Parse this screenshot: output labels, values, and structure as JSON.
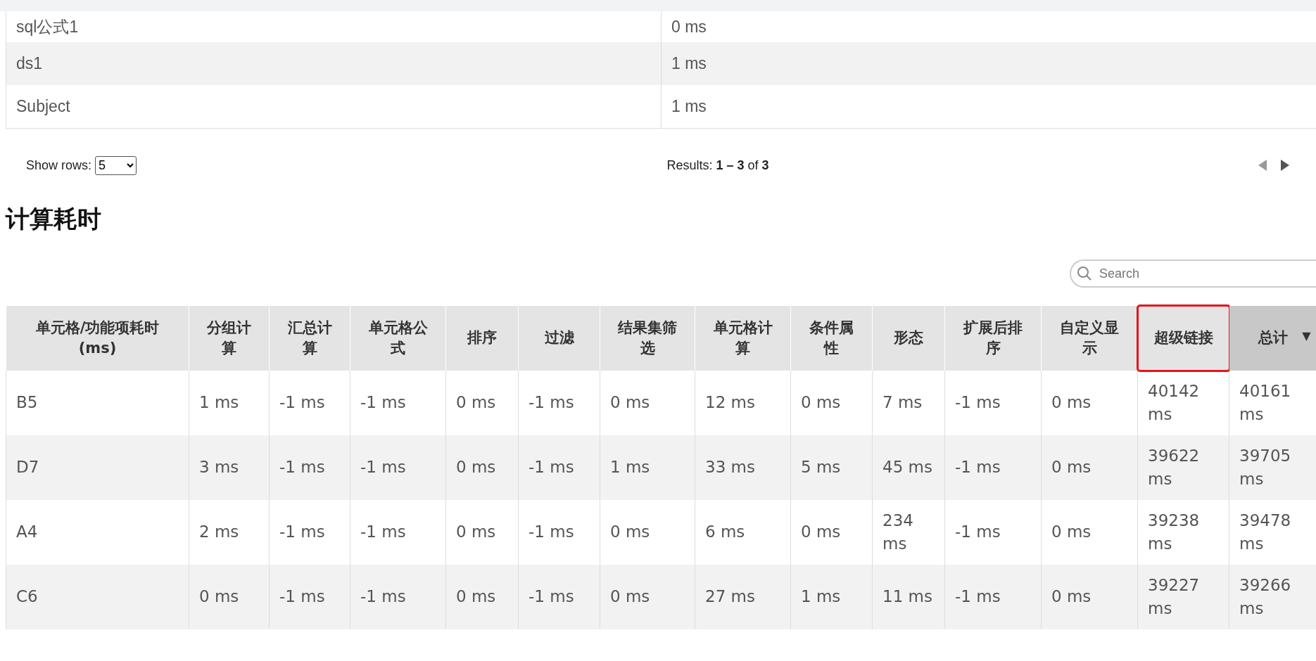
{
  "top_table": {
    "rows": [
      {
        "name": "sql公式1",
        "time": "0 ms"
      },
      {
        "name": "ds1",
        "time": "1 ms"
      },
      {
        "name": "Subject",
        "time": "1 ms"
      }
    ]
  },
  "pagination": {
    "show_rows_label": "Show rows:",
    "rows_value": "5",
    "results_prefix": "Results: ",
    "results_range": "1 – 3",
    "results_of": " of ",
    "results_total": "3",
    "prev_disabled": true,
    "next_disabled": false
  },
  "section_title": "计算耗时",
  "search": {
    "placeholder": "Search"
  },
  "table": {
    "columns": [
      {
        "label": "单元格/功能项耗时(ms)",
        "highlighted": false,
        "sorted": false
      },
      {
        "label": "分组计算",
        "highlighted": false,
        "sorted": false
      },
      {
        "label": "汇总计算",
        "highlighted": false,
        "sorted": false
      },
      {
        "label": "单元格公式",
        "highlighted": false,
        "sorted": false
      },
      {
        "label": "排序",
        "highlighted": false,
        "sorted": false
      },
      {
        "label": "过滤",
        "highlighted": false,
        "sorted": false
      },
      {
        "label": "结果集筛选",
        "highlighted": false,
        "sorted": false
      },
      {
        "label": "单元格计算",
        "highlighted": false,
        "sorted": false
      },
      {
        "label": "条件属性",
        "highlighted": false,
        "sorted": false
      },
      {
        "label": "形态",
        "highlighted": false,
        "sorted": false
      },
      {
        "label": "扩展后排序",
        "highlighted": false,
        "sorted": false
      },
      {
        "label": "自定义显示",
        "highlighted": false,
        "sorted": false
      },
      {
        "label": "超级链接",
        "highlighted": true,
        "sorted": false
      },
      {
        "label": "总计",
        "highlighted": false,
        "sorted": true,
        "sort_icon": "▼"
      }
    ],
    "rows": [
      [
        "B5",
        "1 ms",
        "-1 ms",
        "-1 ms",
        "0 ms",
        "-1 ms",
        "0 ms",
        "12 ms",
        "0 ms",
        "7 ms",
        "-1 ms",
        "0 ms",
        "40142 ms",
        "40161 ms"
      ],
      [
        "D7",
        "3 ms",
        "-1 ms",
        "-1 ms",
        "0 ms",
        "-1 ms",
        "1 ms",
        "33 ms",
        "5 ms",
        "45 ms",
        "-1 ms",
        "0 ms",
        "39622 ms",
        "39705 ms"
      ],
      [
        "A4",
        "2 ms",
        "-1 ms",
        "-1 ms",
        "0 ms",
        "-1 ms",
        "0 ms",
        "6 ms",
        "0 ms",
        "234 ms",
        "-1 ms",
        "0 ms",
        "39238 ms",
        "39478 ms"
      ],
      [
        "C6",
        "0 ms",
        "-1 ms",
        "-1 ms",
        "0 ms",
        "-1 ms",
        "0 ms",
        "27 ms",
        "1 ms",
        "11 ms",
        "-1 ms",
        "0 ms",
        "39227 ms",
        "39266 ms"
      ]
    ]
  }
}
